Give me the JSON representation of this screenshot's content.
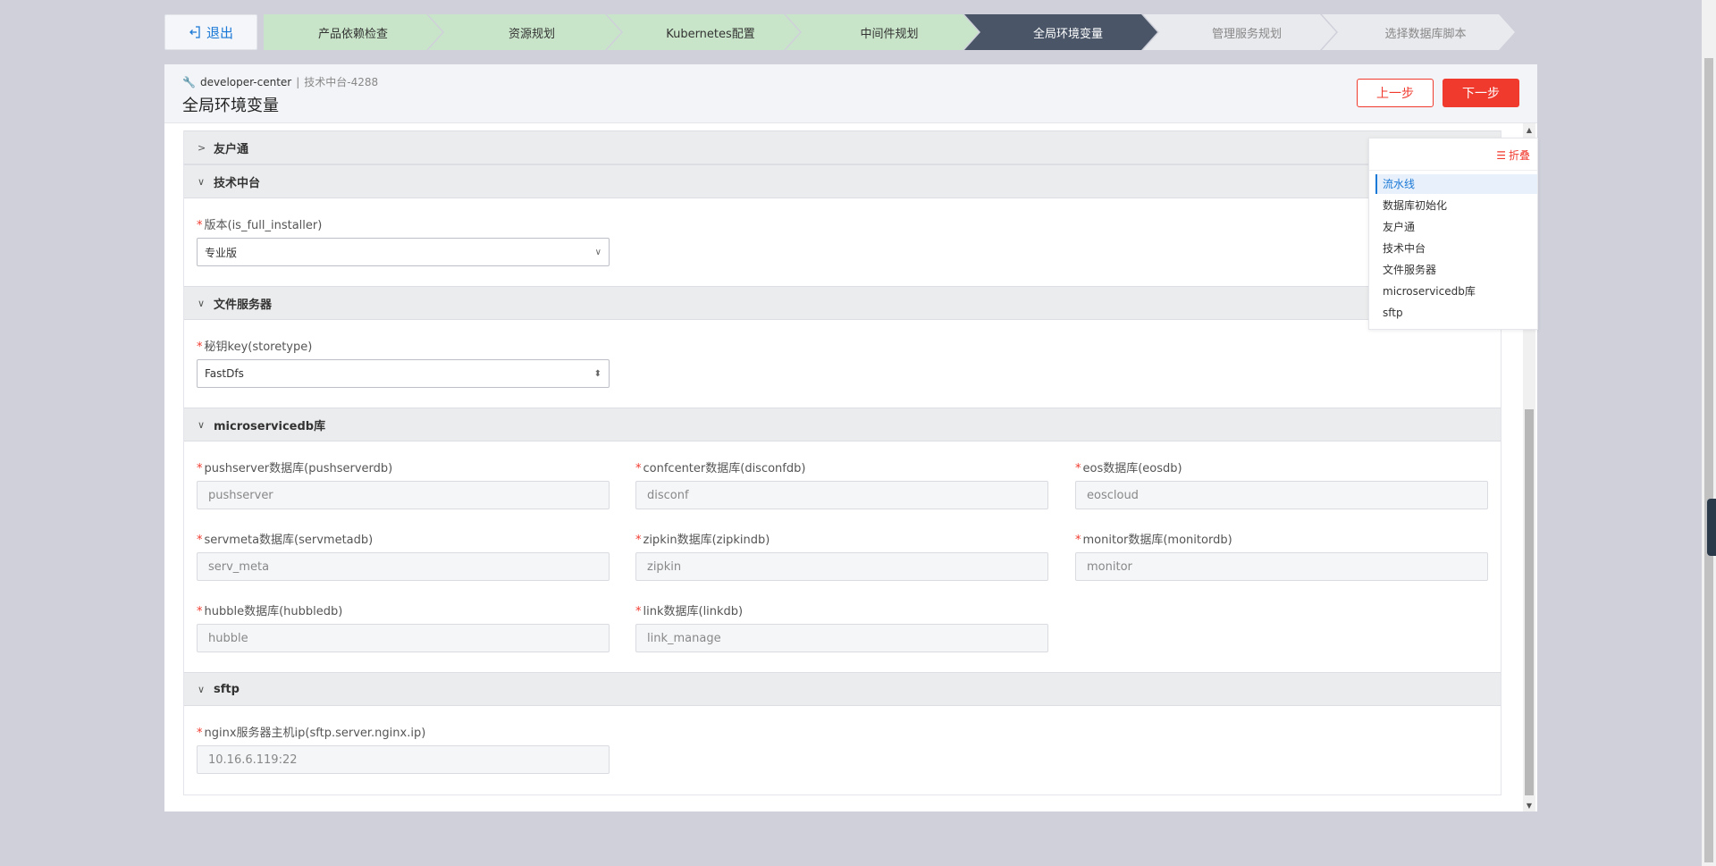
{
  "logout": {
    "label": "退出"
  },
  "steps": [
    {
      "label": "产品依赖检查",
      "state": "done"
    },
    {
      "label": "资源规划",
      "state": "done"
    },
    {
      "label": "Kubernetes配置",
      "state": "done"
    },
    {
      "label": "中间件规划",
      "state": "done"
    },
    {
      "label": "全局环境变量",
      "state": "active"
    },
    {
      "label": "管理服务规划",
      "state": "todo"
    },
    {
      "label": "选择数据库脚本",
      "state": "todo"
    }
  ],
  "header": {
    "project": "developer-center",
    "separator": "|",
    "product": "技术中台-4288",
    "title": "全局环境变量",
    "prev_label": "上一步",
    "next_label": "下一步"
  },
  "sections": {
    "youhutong": {
      "title": "友户通",
      "collapsed": true
    },
    "jszt": {
      "title": "技术中台",
      "fields": [
        {
          "label": "版本(is_full_installer)",
          "value": "专业版",
          "type": "select"
        }
      ]
    },
    "files": {
      "title": "文件服务器",
      "fields": [
        {
          "label": "秘钥key(storetype)",
          "value": "FastDfs",
          "type": "select"
        }
      ]
    },
    "msdb": {
      "title": "microservicedb库",
      "fields": [
        {
          "label": "pushserver数据库(pushserverdb)",
          "value": "pushserver"
        },
        {
          "label": "confcenter数据库(disconfdb)",
          "value": "disconf"
        },
        {
          "label": "eos数据库(eosdb)",
          "value": "eoscloud"
        },
        {
          "label": "servmeta数据库(servmetadb)",
          "value": "serv_meta"
        },
        {
          "label": "zipkin数据库(zipkindb)",
          "value": "zipkin"
        },
        {
          "label": "monitor数据库(monitordb)",
          "value": "monitor"
        },
        {
          "label": "hubble数据库(hubbledb)",
          "value": "hubble"
        },
        {
          "label": "link数据库(linkdb)",
          "value": "link_manage"
        }
      ]
    },
    "sftp": {
      "title": "sftp",
      "fields": [
        {
          "label": "nginx服务器主机ip(sftp.server.nginx.ip)",
          "value": "10.16.6.119:22"
        }
      ]
    }
  },
  "anchor_nav": {
    "fold_label": "折叠",
    "items": [
      "流水线",
      "数据库初始化",
      "友户通",
      "技术中台",
      "文件服务器",
      "microservicedb库",
      "sftp"
    ],
    "active_index": 0
  },
  "colors": {
    "accent": "#f03a2e",
    "link": "#1a78d6",
    "step_done": "#c9e5c9",
    "step_active": "#4a5668",
    "step_todo": "#e9eaee"
  }
}
